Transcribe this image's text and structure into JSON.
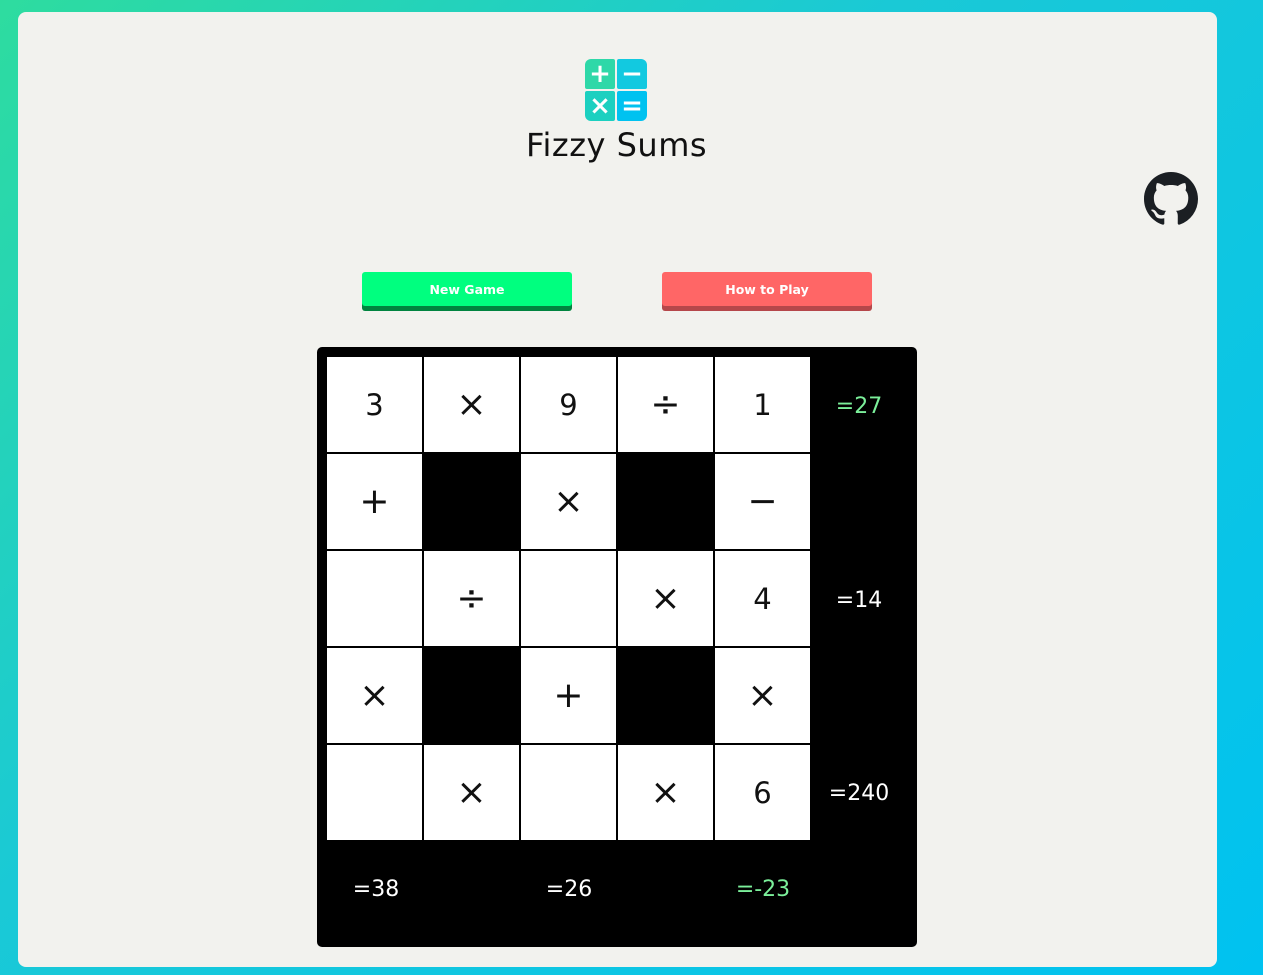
{
  "app": {
    "title": "Fizzy Sums",
    "logo_symbols": [
      "+",
      "−",
      "×",
      "="
    ]
  },
  "header": {
    "github_icon": "github-icon"
  },
  "buttons": {
    "new_game": "New Game",
    "how_to_play": "How to Play"
  },
  "colors": {
    "new_game": "#00ff7f",
    "how_to_play": "#ff6666",
    "solved_sum": "#7bef9a",
    "unsolved_sum": "#ffffff"
  },
  "board": {
    "rows": [
      [
        {
          "v": "3",
          "t": "num"
        },
        {
          "v": "×",
          "t": "op"
        },
        {
          "v": "9",
          "t": "num"
        },
        {
          "v": "÷",
          "t": "op"
        },
        {
          "v": "1",
          "t": "num"
        }
      ],
      [
        {
          "v": "+",
          "t": "op"
        },
        {
          "v": "",
          "t": "block"
        },
        {
          "v": "×",
          "t": "op"
        },
        {
          "v": "",
          "t": "block"
        },
        {
          "v": "−",
          "t": "op"
        }
      ],
      [
        {
          "v": "",
          "t": "empty"
        },
        {
          "v": "÷",
          "t": "op"
        },
        {
          "v": "",
          "t": "empty"
        },
        {
          "v": "×",
          "t": "op"
        },
        {
          "v": "4",
          "t": "num"
        }
      ],
      [
        {
          "v": "×",
          "t": "op"
        },
        {
          "v": "",
          "t": "block"
        },
        {
          "v": "+",
          "t": "op"
        },
        {
          "v": "",
          "t": "block"
        },
        {
          "v": "×",
          "t": "op"
        }
      ],
      [
        {
          "v": "",
          "t": "empty"
        },
        {
          "v": "×",
          "t": "op"
        },
        {
          "v": "",
          "t": "empty"
        },
        {
          "v": "×",
          "t": "op"
        },
        {
          "v": "6",
          "t": "num"
        }
      ]
    ],
    "row_sums": [
      {
        "text": "=27",
        "solved": true
      },
      {
        "text": "=14",
        "solved": false
      },
      {
        "text": "=240",
        "solved": false
      }
    ],
    "col_sums": [
      {
        "text": "=38",
        "solved": false
      },
      {
        "text": "=26",
        "solved": false
      },
      {
        "text": "=-23",
        "solved": true
      }
    ]
  }
}
